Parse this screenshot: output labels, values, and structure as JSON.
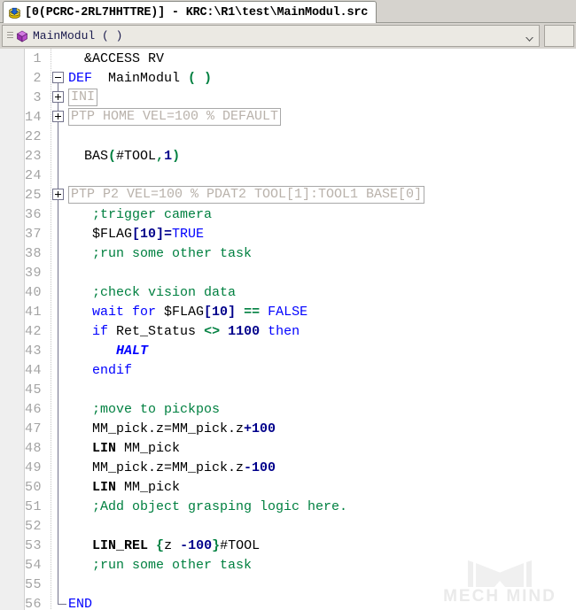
{
  "window": {
    "tab": {
      "icon": "disk-download-icon",
      "title": "[0(PCRC-2RL7HHTTRE)] - KRC:\\R1\\test\\MainModul.src"
    }
  },
  "module_bar": {
    "icon": "purple-cube-icon",
    "label": "MainModul ( )",
    "caret": "chevron-down-icon"
  },
  "editor": {
    "watermark": "MECH MIND",
    "lines": [
      {
        "no": "1",
        "fold": "line",
        "segs": [
          {
            "t": "  ",
            "c": "plain"
          },
          {
            "t": "&ACCESS RV",
            "c": "plain"
          }
        ]
      },
      {
        "no": "2",
        "fold": "minus",
        "segs": [
          {
            "t": "DEF  ",
            "c": "kw"
          },
          {
            "t": "MainModul ",
            "c": "plain"
          },
          {
            "t": "( )",
            "c": "op"
          }
        ]
      },
      {
        "no": "3",
        "fold": "plus",
        "folded": "INI"
      },
      {
        "no": "14",
        "fold": "plus",
        "folded": "PTP HOME VEL=100 % DEFAULT"
      },
      {
        "no": "22",
        "fold": "line",
        "segs": []
      },
      {
        "no": "23",
        "fold": "line",
        "segs": [
          {
            "t": "  BAS",
            "c": "plain"
          },
          {
            "t": "(",
            "c": "op"
          },
          {
            "t": "#TOOL",
            "c": "plain"
          },
          {
            "t": ",",
            "c": "op"
          },
          {
            "t": "1",
            "c": "num"
          },
          {
            "t": ")",
            "c": "op"
          }
        ]
      },
      {
        "no": "24",
        "fold": "line",
        "segs": []
      },
      {
        "no": "25",
        "fold": "plus",
        "folded": "PTP P2 VEL=100 % PDAT2 TOOL[1]:TOOL1 BASE[0]"
      },
      {
        "no": "36",
        "fold": "line",
        "segs": [
          {
            "t": "   ;trigger camera",
            "c": "cmt"
          }
        ]
      },
      {
        "no": "37",
        "fold": "line",
        "segs": [
          {
            "t": "   $FLAG",
            "c": "plain"
          },
          {
            "t": "[10]=",
            "c": "num"
          },
          {
            "t": "TRUE",
            "c": "kw"
          }
        ]
      },
      {
        "no": "38",
        "fold": "line",
        "segs": [
          {
            "t": "   ;run some other task",
            "c": "cmt"
          }
        ]
      },
      {
        "no": "39",
        "fold": "line",
        "segs": []
      },
      {
        "no": "40",
        "fold": "line",
        "segs": [
          {
            "t": "   ;check vision data",
            "c": "cmt"
          }
        ]
      },
      {
        "no": "41",
        "fold": "line",
        "segs": [
          {
            "t": "   ",
            "c": "plain"
          },
          {
            "t": "wait for ",
            "c": "kw"
          },
          {
            "t": "$FLAG",
            "c": "plain"
          },
          {
            "t": "[10]",
            "c": "num"
          },
          {
            "t": " ",
            "c": "plain"
          },
          {
            "t": "==",
            "c": "op"
          },
          {
            "t": " ",
            "c": "plain"
          },
          {
            "t": "FALSE",
            "c": "kw"
          }
        ]
      },
      {
        "no": "42",
        "fold": "line",
        "segs": [
          {
            "t": "   ",
            "c": "plain"
          },
          {
            "t": "if ",
            "c": "kw"
          },
          {
            "t": "Ret_Status ",
            "c": "plain"
          },
          {
            "t": "<>",
            "c": "op"
          },
          {
            "t": " ",
            "c": "plain"
          },
          {
            "t": "1100",
            "c": "num"
          },
          {
            "t": " ",
            "c": "plain"
          },
          {
            "t": "then",
            "c": "kw"
          }
        ]
      },
      {
        "no": "43",
        "fold": "line",
        "segs": [
          {
            "t": "      ",
            "c": "plain"
          },
          {
            "t": "HALT",
            "c": "kwbi"
          }
        ]
      },
      {
        "no": "44",
        "fold": "line",
        "segs": [
          {
            "t": "   ",
            "c": "plain"
          },
          {
            "t": "endif",
            "c": "kw"
          }
        ]
      },
      {
        "no": "45",
        "fold": "line",
        "segs": []
      },
      {
        "no": "46",
        "fold": "line",
        "segs": [
          {
            "t": "   ;move to pickpos",
            "c": "cmt"
          }
        ]
      },
      {
        "no": "47",
        "fold": "line",
        "segs": [
          {
            "t": "   MM_pick.z=MM_pick.z",
            "c": "plain"
          },
          {
            "t": "+100",
            "c": "num"
          }
        ]
      },
      {
        "no": "48",
        "fold": "line",
        "segs": [
          {
            "t": "   ",
            "c": "plain"
          },
          {
            "t": "LIN",
            "c": "bold"
          },
          {
            "t": " MM_pick",
            "c": "plain"
          }
        ]
      },
      {
        "no": "49",
        "fold": "line",
        "segs": [
          {
            "t": "   MM_pick.z=MM_pick.z",
            "c": "plain"
          },
          {
            "t": "-100",
            "c": "num"
          }
        ]
      },
      {
        "no": "50",
        "fold": "line",
        "segs": [
          {
            "t": "   ",
            "c": "plain"
          },
          {
            "t": "LIN",
            "c": "bold"
          },
          {
            "t": " MM_pick",
            "c": "plain"
          }
        ]
      },
      {
        "no": "51",
        "fold": "line",
        "segs": [
          {
            "t": "   ;Add object grasping logic here.",
            "c": "cmt"
          }
        ]
      },
      {
        "no": "52",
        "fold": "line",
        "segs": []
      },
      {
        "no": "53",
        "fold": "line",
        "segs": [
          {
            "t": "   ",
            "c": "plain"
          },
          {
            "t": "LIN_REL",
            "c": "bold"
          },
          {
            "t": " ",
            "c": "plain"
          },
          {
            "t": "{",
            "c": "op"
          },
          {
            "t": "z ",
            "c": "plain"
          },
          {
            "t": "-100",
            "c": "num"
          },
          {
            "t": "}",
            "c": "op"
          },
          {
            "t": "#TOOL",
            "c": "plain"
          }
        ]
      },
      {
        "no": "54",
        "fold": "line",
        "segs": [
          {
            "t": "   ;run some other task",
            "c": "cmt"
          }
        ]
      },
      {
        "no": "55",
        "fold": "line",
        "segs": []
      },
      {
        "no": "56",
        "fold": "elbow",
        "segs": [
          {
            "t": "END",
            "c": "kw"
          }
        ]
      }
    ]
  },
  "colors": {
    "keyword": "#0000ff",
    "comment": "#008040",
    "number": "#00008b",
    "operator": "#008040",
    "linenumber": "#a3a3a3",
    "folded_text": "#b9b2ab",
    "chrome": "#d6d3ce"
  }
}
